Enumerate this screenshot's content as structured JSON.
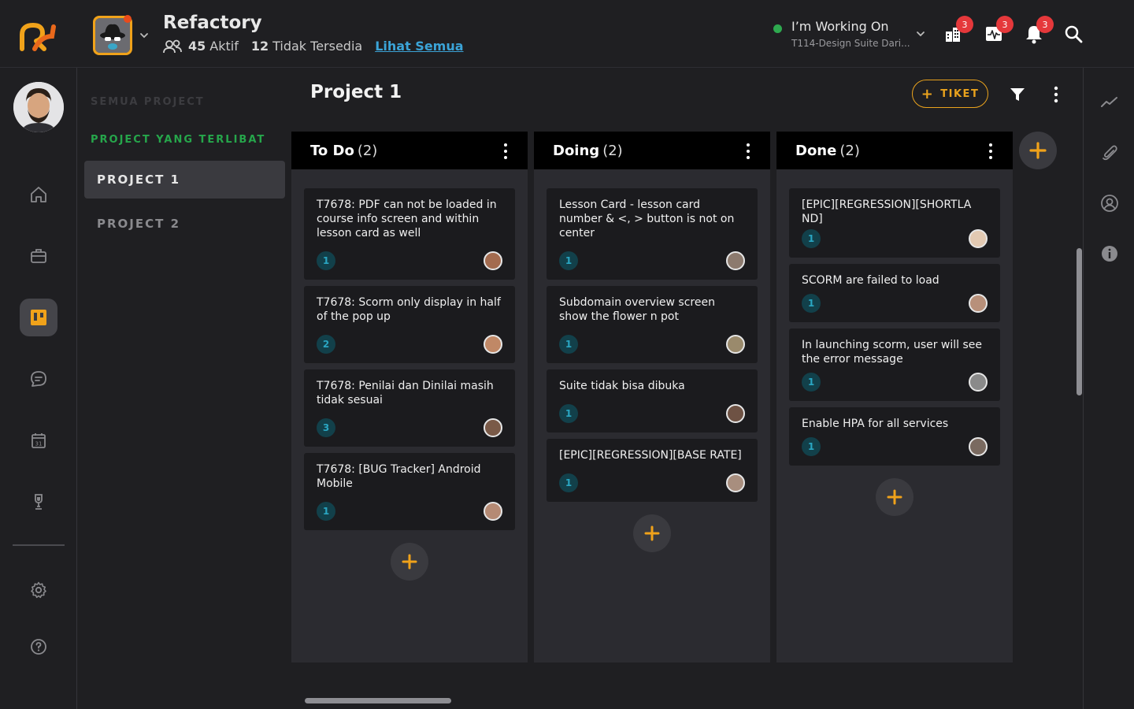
{
  "header": {
    "team_name": "Refactory",
    "active_count": "45",
    "active_label": "Aktif",
    "unavailable_count": "12",
    "unavailable_label": "Tidak Tersedia",
    "see_all_link": "Lihat Semua",
    "working_on_title": "I’m Working On",
    "working_on_task": "T114-Design Suite Dari...",
    "notification_badges": {
      "boards": "3",
      "activity": "3",
      "bell": "3"
    }
  },
  "project_sidebar": {
    "all_projects_label": "SEMUA PROJECT",
    "involved_label": "PROJECT YANG TERLIBAT",
    "projects": [
      {
        "label": "PROJECT 1",
        "active": true
      },
      {
        "label": "PROJECT 2",
        "active": false
      }
    ]
  },
  "board": {
    "title": "Project 1",
    "ticket_button": "TIKET",
    "columns": [
      {
        "name": "To Do",
        "count": "(2)",
        "cards": [
          {
            "title": "T7678: PDF can not be loaded in course info screen and within lesson card as well",
            "num": "1"
          },
          {
            "title": "T7678: Scorm only display in half of the pop up",
            "num": "2"
          },
          {
            "title": "T7678: Penilai dan Dinilai masih tidak sesuai",
            "num": "3"
          },
          {
            "title": "T7678: [BUG Tracker] Android Mobile",
            "num": "1"
          }
        ]
      },
      {
        "name": "Doing",
        "count": "(2)",
        "cards": [
          {
            "title": "Lesson Card - lesson card number & <, > button is not on center",
            "num": "1"
          },
          {
            "title": "Subdomain overview screen show the flower n pot",
            "num": "1"
          },
          {
            "title": "Suite tidak bisa dibuka",
            "num": "1"
          },
          {
            "title": "[EPIC][REGRESSION][BASE RATE]",
            "num": "1"
          }
        ]
      },
      {
        "name": "Done",
        "count": "(2)",
        "cards": [
          {
            "title": "[EPIC][REGRESSION][SHORTLA ND]",
            "num": "1"
          },
          {
            "title": "SCORM are failed to load",
            "num": "1"
          },
          {
            "title": "In launching scorm, user will see the error message",
            "num": "1"
          },
          {
            "title": "Enable HPA for all services",
            "num": "1"
          }
        ]
      }
    ]
  },
  "colors": {
    "accent": "#e9a21d",
    "green": "#26a64b",
    "link": "#3ba4d8",
    "badge": "#e5383b"
  }
}
